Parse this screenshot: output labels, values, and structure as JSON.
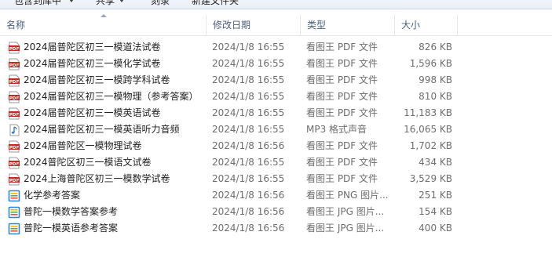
{
  "toolbar": {
    "include_in_library": "包含到库中",
    "share": "共享",
    "burn": "刻录",
    "new_folder": "新建文件夹"
  },
  "columns": {
    "name": "名称",
    "date": "修改日期",
    "type": "类型",
    "size": "大小"
  },
  "files": [
    {
      "name": "2024届普陀区初三一模道法试卷",
      "date": "2024/1/8 16:55",
      "type": "看图王 PDF 文件",
      "size": "826 KB",
      "icon": "pdf-file-icon"
    },
    {
      "name": "2024届普陀区初三一模化学试卷",
      "date": "2024/1/8 16:55",
      "type": "看图王 PDF 文件",
      "size": "1,596 KB",
      "icon": "pdf-file-icon"
    },
    {
      "name": "2024届普陀区初三一模跨学科试卷",
      "date": "2024/1/8 16:55",
      "type": "看图王 PDF 文件",
      "size": "998 KB",
      "icon": "pdf-file-icon"
    },
    {
      "name": "2024届普陀区初三一模物理（参考答案）",
      "date": "2024/1/8 16:55",
      "type": "看图王 PDF 文件",
      "size": "810 KB",
      "icon": "pdf-file-icon"
    },
    {
      "name": "2024届普陀区初三一模英语试卷",
      "date": "2024/1/8 16:55",
      "type": "看图王 PDF 文件",
      "size": "11,183 KB",
      "icon": "pdf-file-icon"
    },
    {
      "name": "2024届普陀区初三一模英语听力音频",
      "date": "2024/1/8 16:55",
      "type": "MP3 格式声音",
      "size": "16,065 KB",
      "icon": "audio-file-icon"
    },
    {
      "name": "2024届普陀区一模物理试卷",
      "date": "2024/1/8 16:56",
      "type": "看图王 PDF 文件",
      "size": "1,702 KB",
      "icon": "pdf-file-icon"
    },
    {
      "name": "2024普陀区初三一模语文试卷",
      "date": "2024/1/8 16:55",
      "type": "看图王 PDF 文件",
      "size": "434 KB",
      "icon": "pdf-file-icon"
    },
    {
      "name": "2024上海普陀区初三一模数学试卷",
      "date": "2024/1/8 16:55",
      "type": "看图王 PDF 文件",
      "size": "3,529 KB",
      "icon": "pdf-file-icon"
    },
    {
      "name": "化学参考答案",
      "date": "2024/1/8 16:56",
      "type": "看图王 PNG 图片...",
      "size": "251 KB",
      "icon": "image-file-icon"
    },
    {
      "name": "普陀一模数学答案参考",
      "date": "2024/1/8 16:56",
      "type": "看图王 JPG 图片...",
      "size": "154 KB",
      "icon": "image-file-icon"
    },
    {
      "name": "普陀一模英语参考答案",
      "date": "2024/1/8 16:56",
      "type": "看图王 JPG 图片...",
      "size": "400 KB",
      "icon": "image-file-icon"
    }
  ],
  "colors": {
    "pdf_icon": "#c8281e",
    "audio_icon": "#3c78c8",
    "image_icon_frame": "#2a86d6",
    "header_text": "#4c607a",
    "detail_text": "#6d6d6d"
  }
}
